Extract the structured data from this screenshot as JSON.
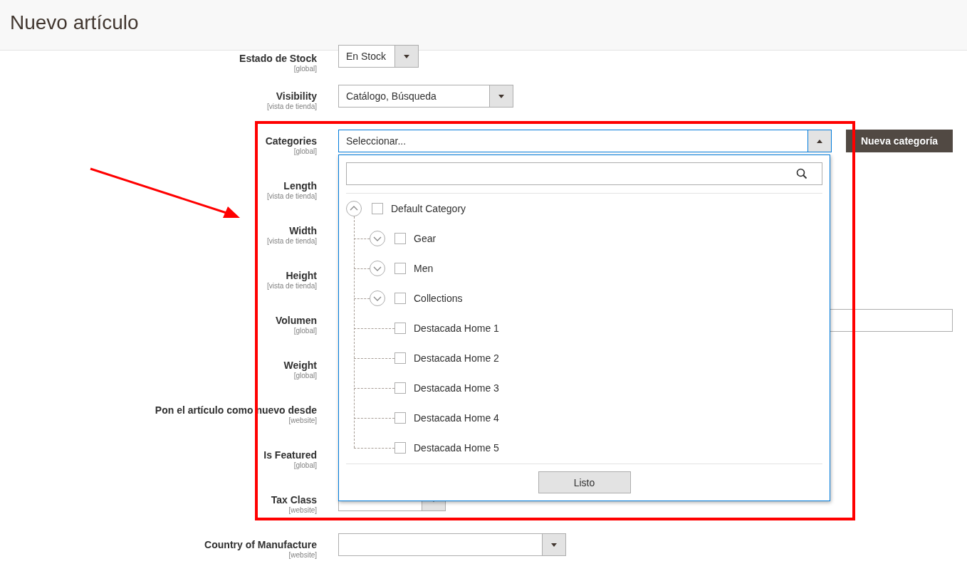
{
  "header": {
    "title": "Nuevo artículo"
  },
  "fields": [
    {
      "label": "Estado de Stock",
      "scope": "[global]",
      "kind": "select",
      "value": "En Stock"
    },
    {
      "label": "Visibility",
      "scope": "[vista de tienda]",
      "kind": "select",
      "value": "Catálogo, Búsqueda"
    },
    {
      "label": "Categories",
      "scope": "[global]",
      "kind": "category-select",
      "placeholder": "Seleccionar...",
      "expanded": true,
      "button": "Nueva categoría"
    },
    {
      "label": "Length",
      "scope": "[vista de tienda]"
    },
    {
      "label": "Width",
      "scope": "[vista de tienda]"
    },
    {
      "label": "Height",
      "scope": "[vista de tienda]"
    },
    {
      "label": "Volumen",
      "scope": "[global]",
      "kind": "text"
    },
    {
      "label": "Weight",
      "scope": "[global]"
    },
    {
      "label": "Pon el artículo como nuevo desde",
      "scope": "[website]"
    },
    {
      "label": "Is Featured",
      "scope": "[global]"
    },
    {
      "label": "Tax Class",
      "scope": "[website]",
      "kind": "select"
    },
    {
      "label": "Country of Manufacture",
      "scope": "[website]",
      "kind": "select"
    }
  ],
  "category_dropdown": {
    "done_button": "Listo",
    "tree": [
      {
        "label": "Default Category",
        "kind": "branch",
        "expanded": true,
        "checked": false,
        "children": [
          {
            "label": "Gear",
            "kind": "branch",
            "expanded": false,
            "checked": false
          },
          {
            "label": "Men",
            "kind": "branch",
            "expanded": false,
            "checked": false
          },
          {
            "label": "Collections",
            "kind": "branch",
            "expanded": false,
            "checked": false
          },
          {
            "label": "Destacada Home 1",
            "kind": "leaf",
            "checked": false
          },
          {
            "label": "Destacada Home 2",
            "kind": "leaf",
            "checked": false
          },
          {
            "label": "Destacada Home 3",
            "kind": "leaf",
            "checked": false
          },
          {
            "label": "Destacada Home 4",
            "kind": "leaf",
            "checked": false
          },
          {
            "label": "Destacada Home 5",
            "kind": "leaf",
            "checked": false
          }
        ]
      }
    ]
  }
}
